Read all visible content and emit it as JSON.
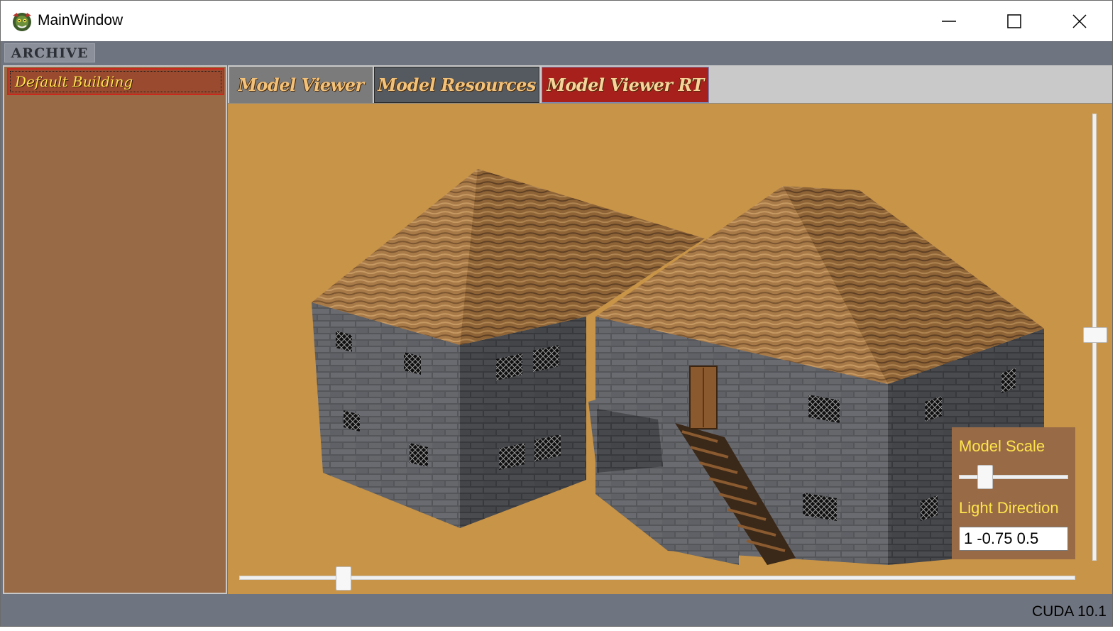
{
  "window": {
    "title": "MainWindow"
  },
  "menu": {
    "archive_label": "ARCHIVE"
  },
  "tree": {
    "items": [
      {
        "label": "Default Building",
        "selected": true
      }
    ]
  },
  "tabs": [
    {
      "label": "Model Viewer",
      "active": true
    },
    {
      "label": "Model Resources",
      "active": false
    },
    {
      "label": "Model Viewer RT",
      "active": false
    }
  ],
  "controls": {
    "scale_label": "Model Scale",
    "light_label": "Light Direction",
    "light_value": "1 -0.75 0.5",
    "scale_fraction": 0.24
  },
  "sliders": {
    "horizontal_fraction": 0.12,
    "vertical_fraction": 0.5
  },
  "status": {
    "text": "CUDA 10.1"
  },
  "colors": {
    "viewport_bg": "#c89447",
    "panel_bg": "#986b46",
    "chrome": "#6f7580",
    "label_yellow": "#ffe44c",
    "tab_active": "#7b7b7b",
    "tab_rt": "#a8201c"
  },
  "icons": {
    "app": "dragon-app-icon",
    "minimize": "minimize-icon",
    "maximize": "maximize-icon",
    "close": "close-icon"
  }
}
